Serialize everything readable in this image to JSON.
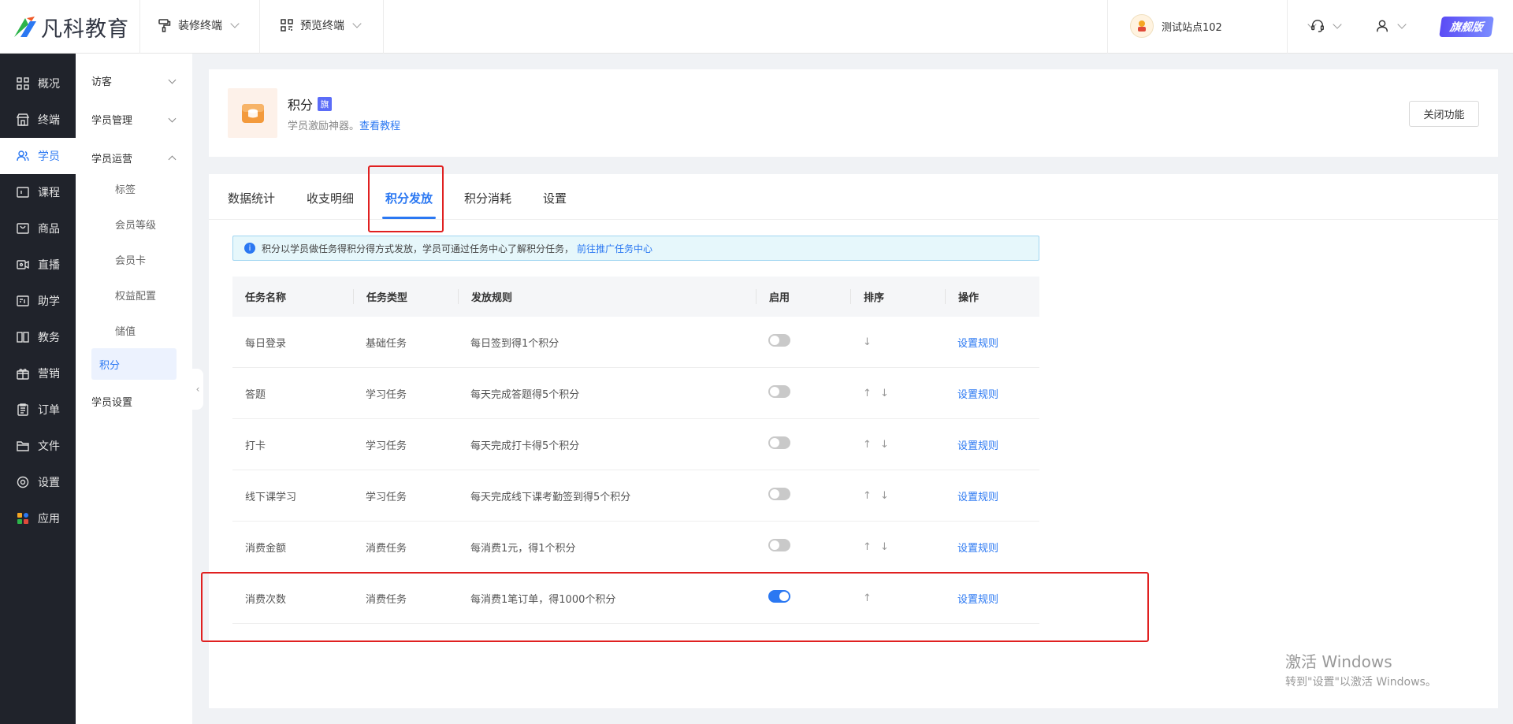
{
  "brand": {
    "name": "凡科教育"
  },
  "topbar": {
    "tools": [
      {
        "label": "装修终端",
        "icon": "paint-roller-icon"
      },
      {
        "label": "预览终端",
        "icon": "qr-grid-icon"
      }
    ],
    "site": {
      "label": "测试站点102"
    },
    "badge": "旗舰版"
  },
  "sidebar": {
    "items": [
      {
        "label": "概况",
        "icon": "grid-icon"
      },
      {
        "label": "终端",
        "icon": "store-icon"
      },
      {
        "label": "学员",
        "icon": "users-icon",
        "active": true
      },
      {
        "label": "课程",
        "icon": "course-icon"
      },
      {
        "label": "商品",
        "icon": "bag-icon"
      },
      {
        "label": "直播",
        "icon": "live-icon"
      },
      {
        "label": "助学",
        "icon": "help-study-icon"
      },
      {
        "label": "教务",
        "icon": "book-icon"
      },
      {
        "label": "营销",
        "icon": "gift-icon"
      },
      {
        "label": "订单",
        "icon": "order-icon"
      },
      {
        "label": "文件",
        "icon": "folder-icon"
      },
      {
        "label": "设置",
        "icon": "gear-icon"
      },
      {
        "label": "应用",
        "icon": "apps-icon"
      }
    ]
  },
  "subnav": {
    "group_visitor": "访客",
    "group_manage": "学员管理",
    "group_ops": "学员运营",
    "items": [
      "标签",
      "会员等级",
      "会员卡",
      "权益配置",
      "储值",
      "积分"
    ],
    "group_settings": "学员设置"
  },
  "header": {
    "title": "积分",
    "flag": "旗",
    "desc": "学员激励神器。",
    "tutorial_link": "查看教程",
    "close_button": "关闭功能"
  },
  "tabs": [
    "数据统计",
    "收支明细",
    "积分发放",
    "积分消耗",
    "设置"
  ],
  "notice": {
    "text": "积分以学员做任务得积分得方式发放，学员可通过任务中心了解积分任务，",
    "link": "前往推广任务中心"
  },
  "table": {
    "headers": [
      "任务名称",
      "任务类型",
      "发放规则",
      "启用",
      "排序",
      "操作"
    ],
    "rows": [
      {
        "name": "每日登录",
        "type": "基础任务",
        "rule": "每日签到得1个积分",
        "enabled": false,
        "up": false,
        "down": true,
        "action": "设置规则"
      },
      {
        "name": "答题",
        "type": "学习任务",
        "rule": "每天完成答题得5个积分",
        "enabled": false,
        "up": true,
        "down": true,
        "action": "设置规则"
      },
      {
        "name": "打卡",
        "type": "学习任务",
        "rule": "每天完成打卡得5个积分",
        "enabled": false,
        "up": true,
        "down": true,
        "action": "设置规则"
      },
      {
        "name": "线下课学习",
        "type": "学习任务",
        "rule": "每天完成线下课考勤签到得5个积分",
        "enabled": false,
        "up": true,
        "down": true,
        "action": "设置规则"
      },
      {
        "name": "消费金额",
        "type": "消费任务",
        "rule": "每消费1元，得1个积分",
        "enabled": false,
        "up": true,
        "down": true,
        "action": "设置规则"
      },
      {
        "name": "消费次数",
        "type": "消费任务",
        "rule": "每消费1笔订单，得1000个积分",
        "enabled": true,
        "up": true,
        "down": false,
        "action": "设置规则"
      }
    ]
  },
  "watermark": {
    "line1": "激活 Windows",
    "line2": "转到\"设置\"以激活 Windows。"
  },
  "colors": {
    "accent": "#2b78f2",
    "sidebar_bg": "#20232b",
    "highlight_box": "#e02020"
  }
}
